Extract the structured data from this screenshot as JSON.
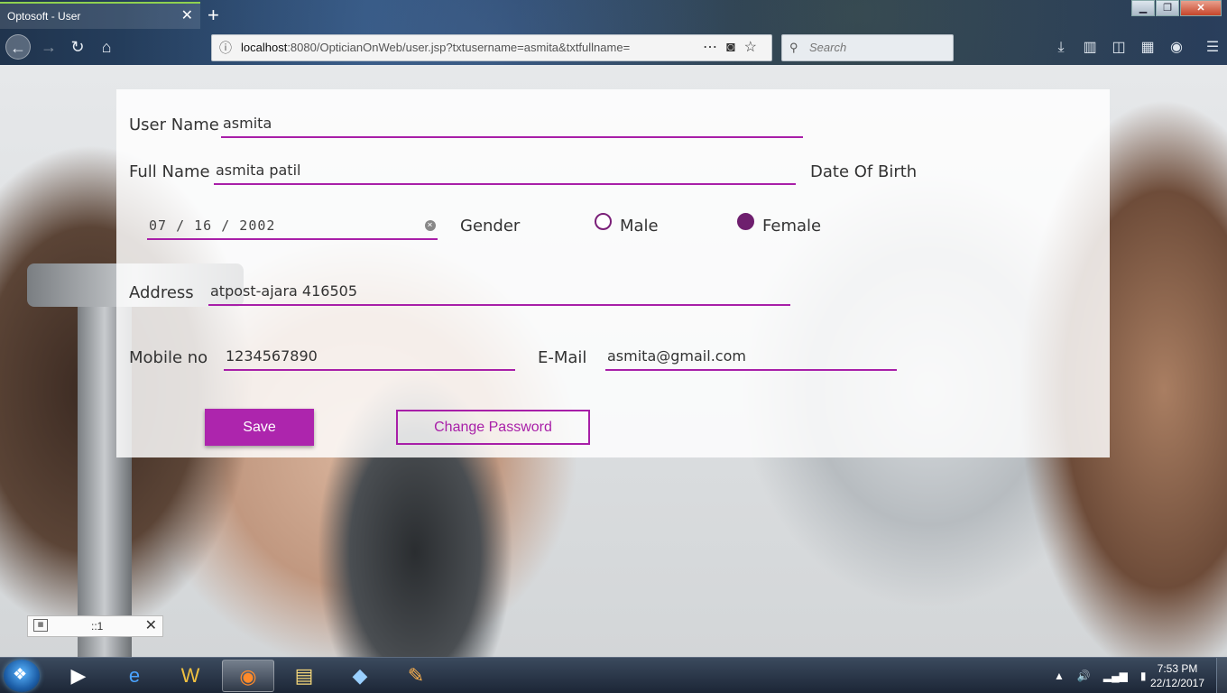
{
  "browser": {
    "tab_title": "Optosoft - User",
    "tab_close": "✕",
    "new_tab": "+",
    "url_host": "localhost",
    "url_rest": ":8080/OpticianOnWeb/user.jsp?txtusername=asmita&txtfullname=",
    "search_placeholder": "Search",
    "window_min": "▁",
    "window_max": "❐",
    "window_close": "✕"
  },
  "form": {
    "username_label": "User Name",
    "username_value": "asmita",
    "fullname_label": "Full Name",
    "fullname_value": "asmita patil",
    "dob_label": "Date Of Birth",
    "dob_value": "07 / 16 / 2002",
    "gender_label": "Gender",
    "gender_male": "Male",
    "gender_female": "Female",
    "gender_selected": "Female",
    "address_label": "Address",
    "address_value": "atpost-ajara 416505",
    "mobile_label": "Mobile no",
    "mobile_value": "1234567890",
    "email_label": "E-Mail",
    "email_value": "asmita@gmail.com",
    "save_button": "Save",
    "change_password_button": "Change Password"
  },
  "popup": {
    "text": "::1",
    "close": "✕"
  },
  "taskbar": {
    "time": "7:53 PM",
    "date": "22/12/2017"
  },
  "colors": {
    "accent": "#a81fa8",
    "radio_selected": "#6e1f6e"
  }
}
